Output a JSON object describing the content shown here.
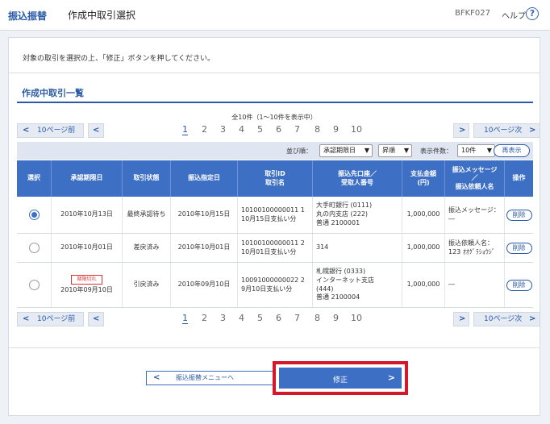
{
  "header": {
    "title": "振込振替",
    "subtitle": "作成中取引選択",
    "code": "BFKF027",
    "help": "ヘルプ",
    "help_icon": "?"
  },
  "instructions": "対象の取引を選択の上、「修正」ボタンを押してください。",
  "section_title": "作成中取引一覧",
  "count_text": "全10件（1〜10件を表示中）",
  "pager": {
    "prev_label": "10ページ前",
    "next_label": "10ページ次",
    "pages": [
      "1",
      "2",
      "3",
      "4",
      "5",
      "6",
      "7",
      "8",
      "9",
      "10"
    ],
    "active_page": "1"
  },
  "toolbar": {
    "sort_label": "並び順：",
    "sort_value": "承認期限日",
    "order_value": "昇順",
    "per_page_label": "表示件数：",
    "per_page_value": "10件",
    "redisplay": "再表示"
  },
  "table": {
    "headers": [
      "選択",
      "承認期限日",
      "取引状態",
      "振込指定日",
      "取引ID\n取引名",
      "振込先口座／\n受取人番号",
      "支払金額\n(円)",
      "振込メッセージ\n／\n振込依頼人名",
      "操作"
    ],
    "rows": [
      {
        "selected": true,
        "expired_tag": "",
        "approval_date": "2010年10月13日",
        "status": "最終承認待ち",
        "transfer_date": "2010年10月15日",
        "tx_id_name": "10100100000011 1\n10月15日支払い分",
        "dest": "大手町銀行 (0111)\n丸の内支店 (222)\n普通 2100001",
        "amount": "1,000,000",
        "message": "振込メッセージ：\n―",
        "action": "削除"
      },
      {
        "selected": false,
        "expired_tag": "",
        "approval_date": "2010年10月01日",
        "status": "差戻済み",
        "transfer_date": "2010年10月01日",
        "tx_id_name": "10100100000011 2\n10月01日支払い分",
        "dest": "314",
        "amount": "1,000,000",
        "message": "振込依頼人名：\n123 ｵｵｸﾞﾗｼｮｳｼﾞ",
        "action": "削除"
      },
      {
        "selected": false,
        "expired_tag": "期限切れ",
        "approval_date": "2010年09月10日",
        "status": "引戻済み",
        "transfer_date": "2010年09月10日",
        "tx_id_name": "10091000000022 2\n9月10日支払い分",
        "dest": "札幌銀行 (0333)\nインターネット支店\n(444)\n普通 2100004",
        "amount": "1,000,000",
        "message": "―",
        "action": "削除"
      }
    ]
  },
  "buttons": {
    "back": "振込振替メニューへ",
    "submit": "修正"
  },
  "colors": {
    "accent": "#3d6fc4",
    "title": "#2a5aa6",
    "highlight_border": "#d4182a",
    "expired": "#d33333"
  }
}
